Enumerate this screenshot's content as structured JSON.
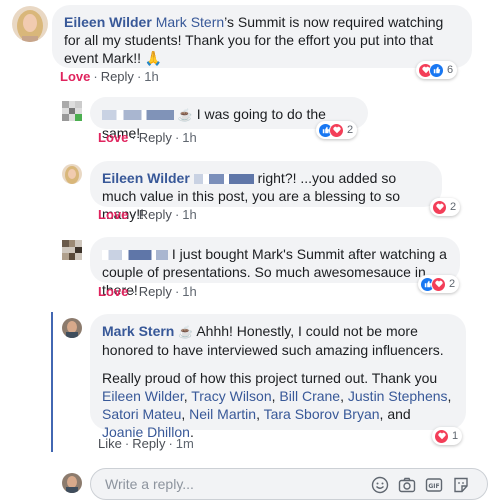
{
  "comments": [
    {
      "author": "Eileen Wilder",
      "text_prefix": "Mark Stern",
      "text": "’s Summit is now required watching for all my students! Thank you for the effort you put into that event Mark!! 🙏",
      "actions": {
        "love": "Love",
        "reply": "Reply",
        "time": "1h"
      },
      "reaction_count": "6"
    },
    {
      "author": "",
      "text": "I was going to do the same!",
      "actions": {
        "love": "Love",
        "reply": "Reply",
        "time": "1h"
      },
      "reaction_count": "2"
    },
    {
      "author": "Eileen Wilder",
      "text": "right?! ...you added so much value in this post, you are a blessing to so many!!",
      "actions": {
        "love": "Love",
        "reply": "Reply",
        "time": "1h"
      },
      "reaction_count": "2"
    },
    {
      "author": "",
      "text": "I just bought Mark's Summit after watching a couple of presentations. So much awesomesauce in there!",
      "actions": {
        "love": "Love",
        "reply": "Reply",
        "time": "1h"
      },
      "reaction_count": "2"
    },
    {
      "author": "Mark Stern",
      "text": "Ahhh! Honestly, I could not be more honored to have interviewed such amazing influencers.",
      "text2": "Really proud of how this project turned out. Thank you",
      "mentions": [
        "Eileen Wilder",
        "Tracy Wilson",
        "Bill Crane",
        "Justin Stephens",
        "Satori Mateu",
        "Neil Martin",
        "Tara Sborov Bryan",
        "Joanie Dhillon"
      ],
      "sep": ", ",
      "and": ", and ",
      "end": ".",
      "actions": {
        "like": "Like",
        "reply": "Reply",
        "time": "1m"
      },
      "reaction_count": "1"
    }
  ],
  "reply_input": {
    "placeholder": "Write a reply..."
  },
  "colors": {
    "link": "#385898",
    "love": "#e0245e",
    "bubble": "#f2f3f5",
    "thread": "#4267b2"
  },
  "icons": [
    "emoji-icon",
    "camera-icon",
    "gif-icon",
    "sticker-icon",
    "coffee-icon",
    "heart-reaction-icon",
    "like-reaction-icon"
  ]
}
